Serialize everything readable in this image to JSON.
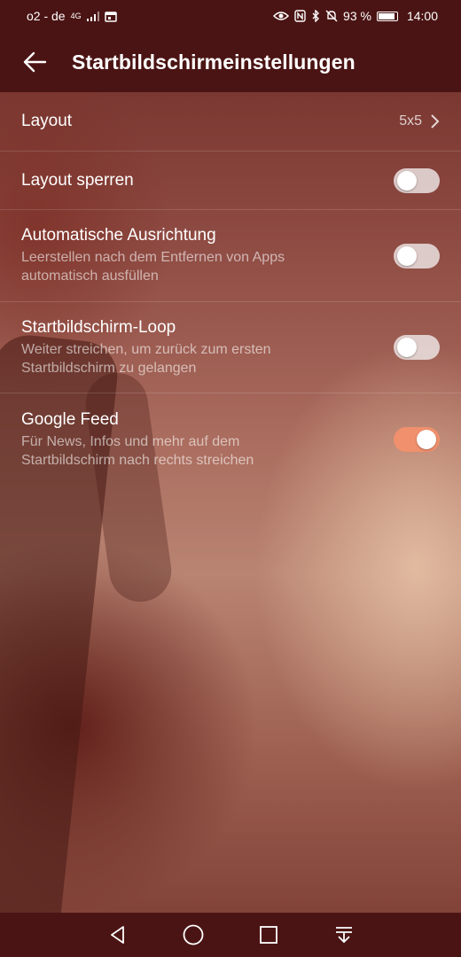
{
  "status_bar": {
    "carrier": "o2 - de",
    "network": "4G",
    "battery": "93 %",
    "time": "14:00"
  },
  "app_bar": {
    "title": "Startbildschirmeinstellungen"
  },
  "settings": {
    "layout": {
      "title": "Layout",
      "value": "5x5"
    },
    "lock_layout": {
      "title": "Layout sperren",
      "enabled": false
    },
    "auto_align": {
      "title": "Automatische Ausrichtung",
      "subtitle": "Leerstellen nach dem Entfernen von Apps automatisch ausfüllen",
      "enabled": false
    },
    "loop": {
      "title": "Startbildschirm-Loop",
      "subtitle": "Weiter streichen, um zurück zum ersten Startbildschirm zu gelangen",
      "enabled": false
    },
    "google_feed": {
      "title": "Google Feed",
      "subtitle": "Für News, Infos und mehr auf dem Startbildschirm nach rechts streichen",
      "enabled": true
    }
  },
  "colors": {
    "bar_background": "#4b1414",
    "toggle_on": "#f0906c",
    "toggle_off": "#f0ebeb"
  }
}
